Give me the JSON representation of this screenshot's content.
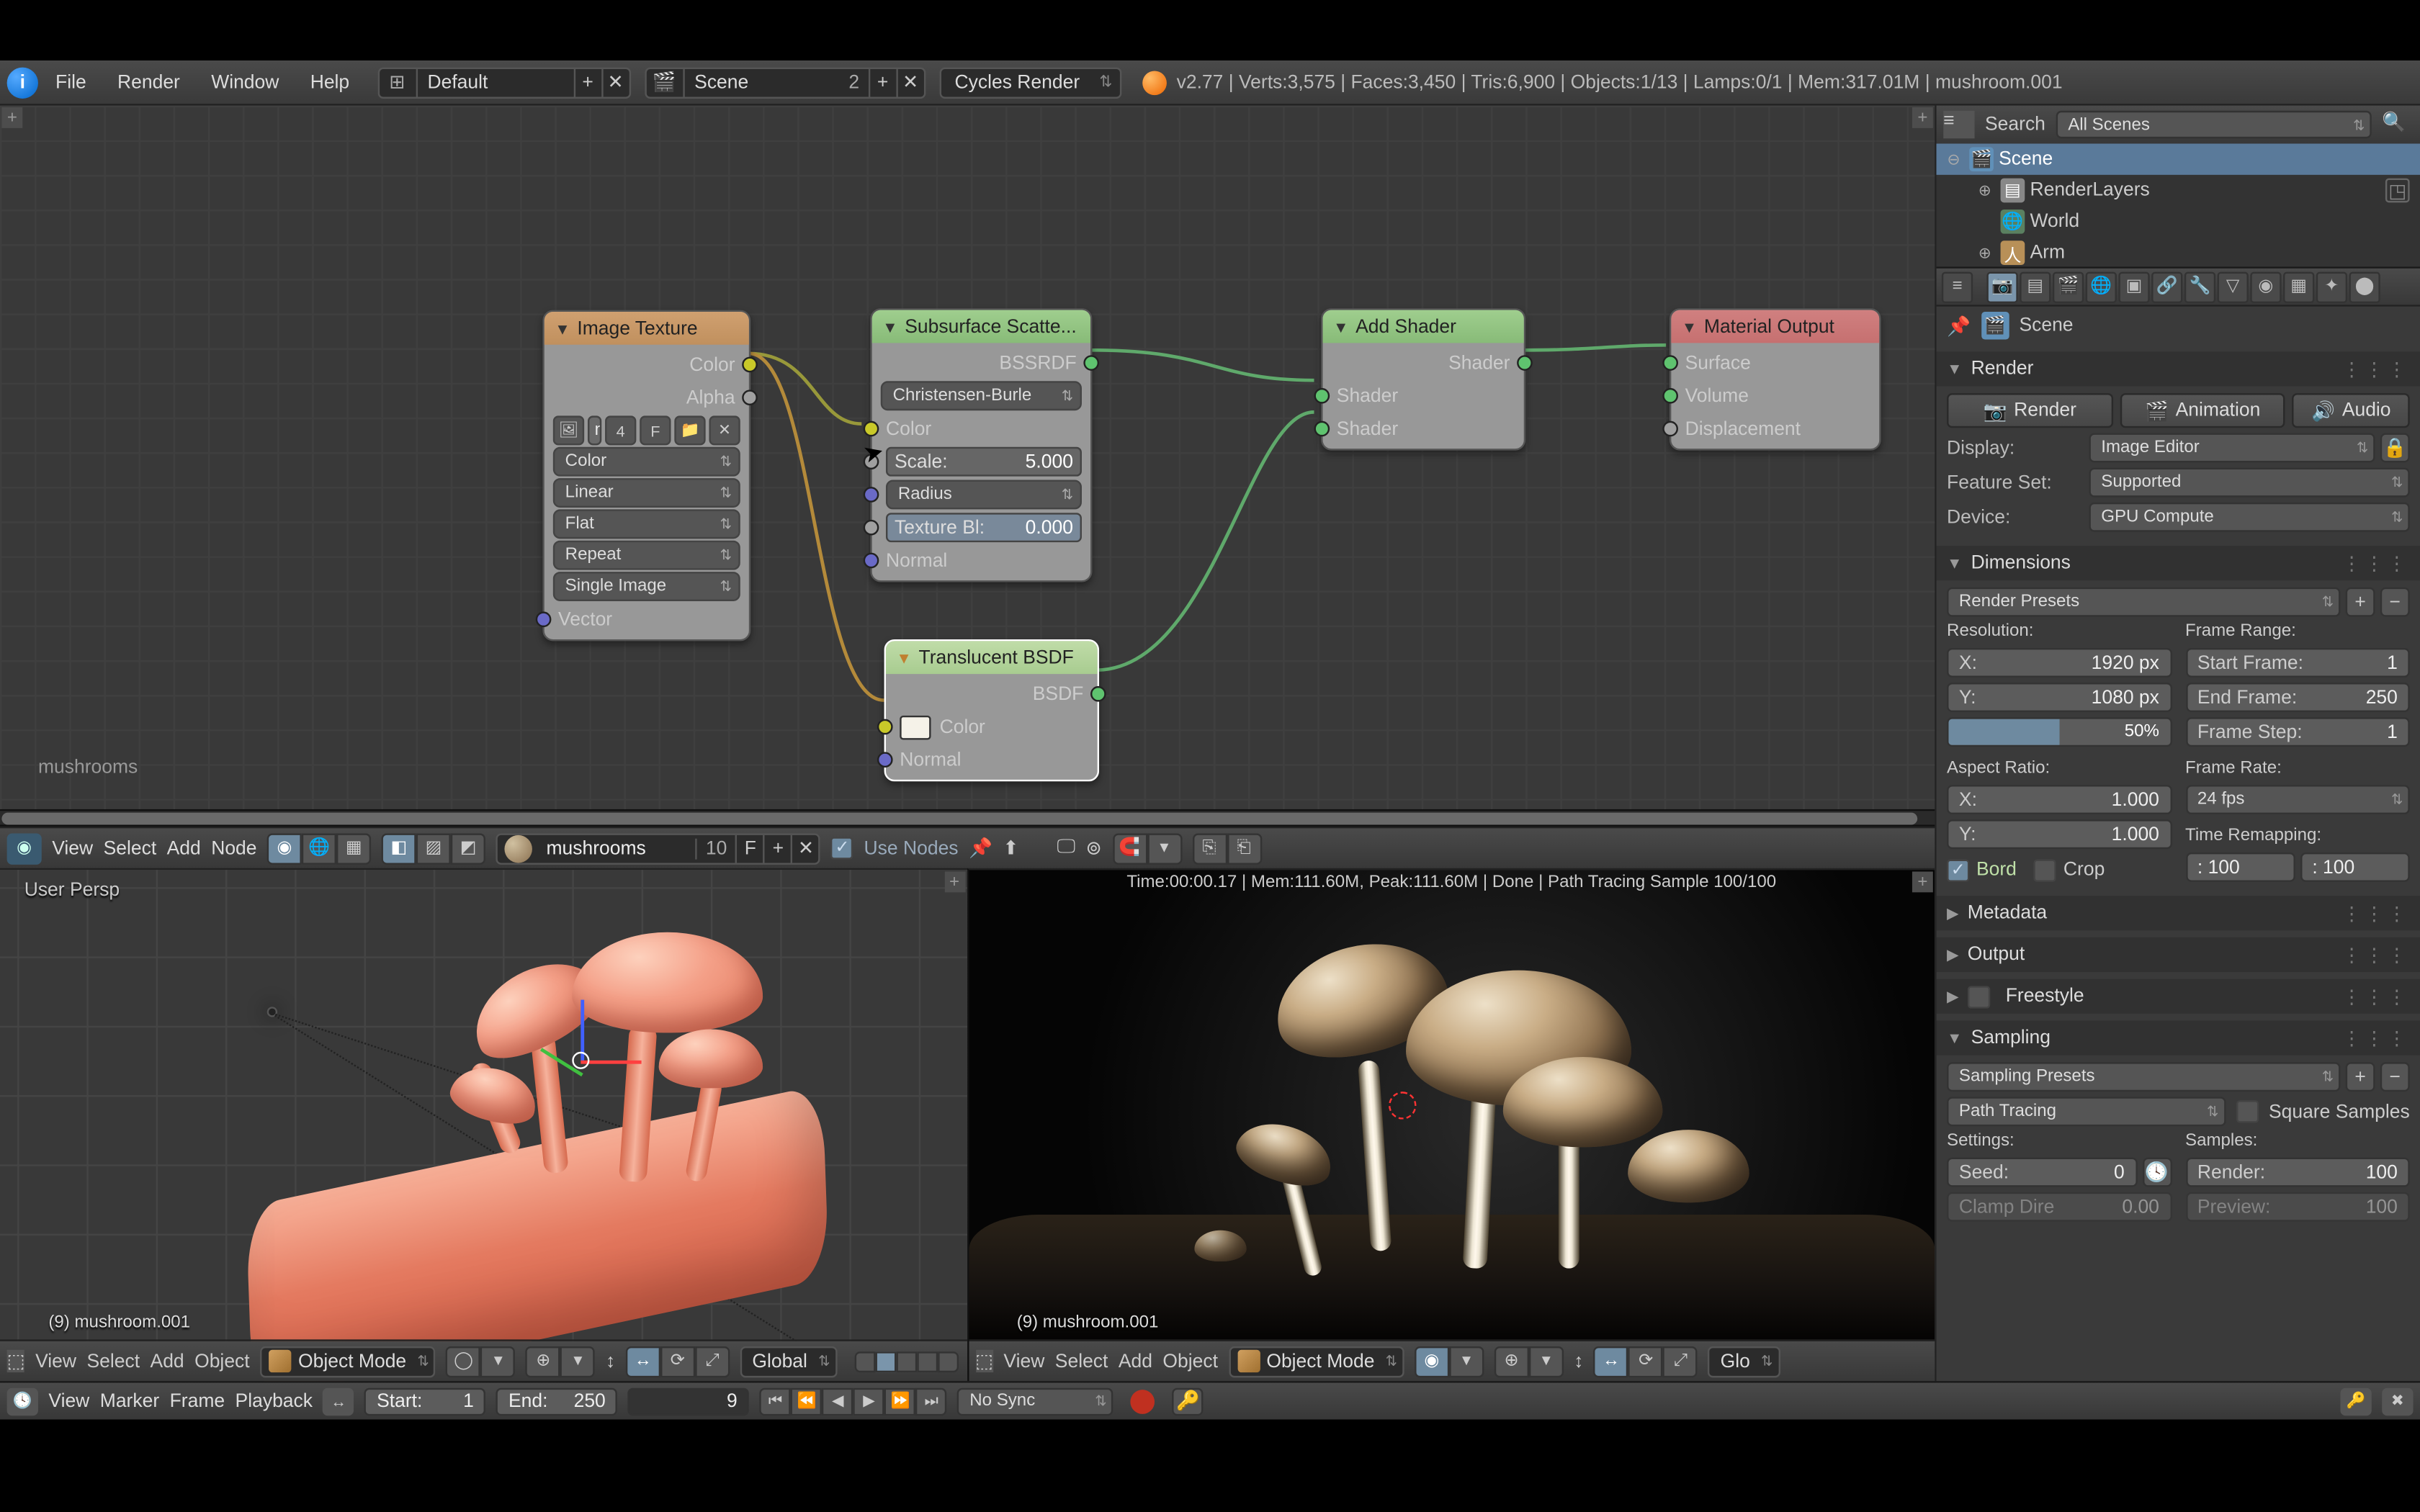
{
  "menubar": {
    "file": "File",
    "render": "Render",
    "window": "Window",
    "help": "Help",
    "layoutName": "Default",
    "layoutCount": "",
    "sceneName": "Scene",
    "sceneUsers": "2",
    "renderEngine": "Cycles Render",
    "stats": "v2.77 | Verts:3,575 | Faces:3,450 | Tris:6,900 | Objects:1/13 | Lamps:0/1 | Mem:317.01M | mushroom.001"
  },
  "outliner": {
    "searchLabel": "Search",
    "filter": "All Scenes",
    "rows": [
      "Scene",
      "RenderLayers",
      "World",
      "Arm"
    ]
  },
  "props": {
    "breadcrumb": "Scene",
    "render": {
      "title": "Render",
      "btn_render": "Render",
      "btn_anim": "Animation",
      "btn_audio": "Audio",
      "display_lbl": "Display:",
      "display_val": "Image Editor",
      "feature_lbl": "Feature Set:",
      "feature_val": "Supported",
      "device_lbl": "Device:",
      "device_val": "GPU Compute"
    },
    "dimensions": {
      "title": "Dimensions",
      "presets": "Render Presets",
      "res_lbl": "Resolution:",
      "frm_lbl": "Frame Range:",
      "resX_k": "X:",
      "resX_v": "1920 px",
      "resY_k": "Y:",
      "resY_v": "1080 px",
      "scale": "50%",
      "start_k": "Start Frame:",
      "start_v": "1",
      "end_k": "End Frame:",
      "end_v": "250",
      "step_k": "Frame Step:",
      "step_v": "1",
      "ar_lbl": "Aspect Ratio:",
      "fr_lbl": "Frame Rate:",
      "arX_k": "X:",
      "arX_v": "1.000",
      "arY_k": "Y:",
      "arY_v": "1.000",
      "fps": "24 fps",
      "remap_lbl": "Time Remapping:",
      "remap_old": ": 100",
      "remap_new": ": 100",
      "border": "Bord",
      "crop": "Crop"
    },
    "metadata": "Metadata",
    "output": "Output",
    "freestyle": "Freestyle",
    "sampling": {
      "title": "Sampling",
      "presets": "Sampling Presets",
      "integrator": "Path Tracing",
      "square": "Square Samples",
      "settings_lbl": "Settings:",
      "samples_lbl": "Samples:",
      "seed_k": "Seed:",
      "seed_v": "0",
      "render_k": "Render:",
      "render_v": "100",
      "clamp_k": "Clamp Dire",
      "clamp_v": "0.00",
      "preview_k": "Preview:",
      "preview_v": "100"
    }
  },
  "nodeeditor": {
    "matlabel": "mushrooms",
    "view": "View",
    "select": "Select",
    "add": "Add",
    "node": "Node",
    "matname": "mushrooms",
    "users": "10",
    "fake": "F",
    "usenodes": "Use Nodes"
  },
  "nodes": {
    "imgtex": {
      "title": "Image Texture",
      "out_color": "Color",
      "out_alpha": "Alpha",
      "imgname": "mu",
      "imgusers": "4",
      "fake": "F",
      "colspace": "Color",
      "interp": "Linear",
      "proj": "Flat",
      "ext": "Repeat",
      "src": "Single Image",
      "in_vector": "Vector"
    },
    "sss": {
      "title": "Subsurface Scatte...",
      "out": "BSSRDF",
      "falloff": "Christensen-Burle",
      "in_color": "Color",
      "scale_k": "Scale:",
      "scale_v": "5.000",
      "radius": "Radius",
      "txblur_k": "Texture Bl:",
      "txblur_v": "0.000",
      "normal": "Normal"
    },
    "translucent": {
      "title": "Translucent BSDF",
      "out": "BSDF",
      "color": "Color",
      "normal": "Normal"
    },
    "add": {
      "title": "Add Shader",
      "out": "Shader",
      "in1": "Shader",
      "in2": "Shader"
    },
    "matout": {
      "title": "Material Output",
      "surface": "Surface",
      "volume": "Volume",
      "disp": "Displacement"
    }
  },
  "vpLeft": {
    "persp": "User Persp",
    "objname": "(9) mushroom.001",
    "view": "View",
    "select": "Select",
    "add": "Add",
    "object": "Object",
    "mode": "Object Mode",
    "orient": "Global"
  },
  "vpRight": {
    "info": "Time:00:00.17 | Mem:111.60M, Peak:111.60M | Done | Path Tracing Sample 100/100",
    "objname": "(9) mushroom.001",
    "view": "View",
    "select": "Select",
    "add": "Add",
    "object": "Object",
    "mode": "Object Mode",
    "orient": "Glo"
  },
  "timeline": {
    "view": "View",
    "marker": "Marker",
    "frame": "Frame",
    "playback": "Playback",
    "start_k": "Start:",
    "start_v": "1",
    "end_k": "End:",
    "end_v": "250",
    "current": "9",
    "sync": "No Sync"
  }
}
